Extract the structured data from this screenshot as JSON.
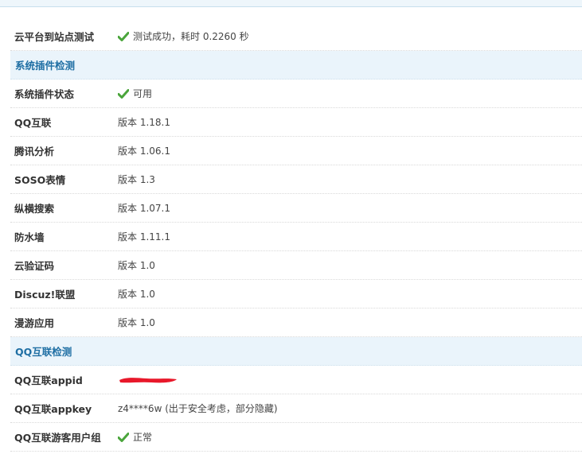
{
  "rows": [
    {
      "type": "item",
      "label": "云平台到站点测试",
      "value": "测试成功，耗时 0.2260 秒",
      "icon": "check-icon"
    },
    {
      "type": "section",
      "title": "系统插件检测"
    },
    {
      "type": "item",
      "label": "系统插件状态",
      "value": "可用",
      "icon": "check-icon"
    },
    {
      "type": "item",
      "label": "QQ互联",
      "value": "版本 1.18.1"
    },
    {
      "type": "item",
      "label": "腾讯分析",
      "value": "版本 1.06.1"
    },
    {
      "type": "item",
      "label": "SOSO表情",
      "value": "版本 1.3"
    },
    {
      "type": "item",
      "label": "纵横搜索",
      "value": "版本 1.07.1"
    },
    {
      "type": "item",
      "label": "防水墙",
      "value": "版本 1.11.1"
    },
    {
      "type": "item",
      "label": "云验证码",
      "value": "版本 1.0"
    },
    {
      "type": "item",
      "label": "Discuz!联盟",
      "value": "版本 1.0"
    },
    {
      "type": "item",
      "label": "漫游应用",
      "value": "版本 1.0"
    },
    {
      "type": "section",
      "title": "QQ互联检测"
    },
    {
      "type": "item",
      "label": "QQ互联appid",
      "value": "",
      "icon": "redacted-mark"
    },
    {
      "type": "item",
      "label": "QQ互联appkey",
      "value": "z4****6w (出于安全考虑，部分隐藏)"
    },
    {
      "type": "item",
      "label": "QQ互联游客用户组",
      "value": "正常",
      "icon": "check-icon"
    }
  ],
  "colors": {
    "section_bg": "#eaf4fb",
    "section_text": "#1f6fa4",
    "check_green": "#4aa53b",
    "redact_red": "#e8182a"
  }
}
